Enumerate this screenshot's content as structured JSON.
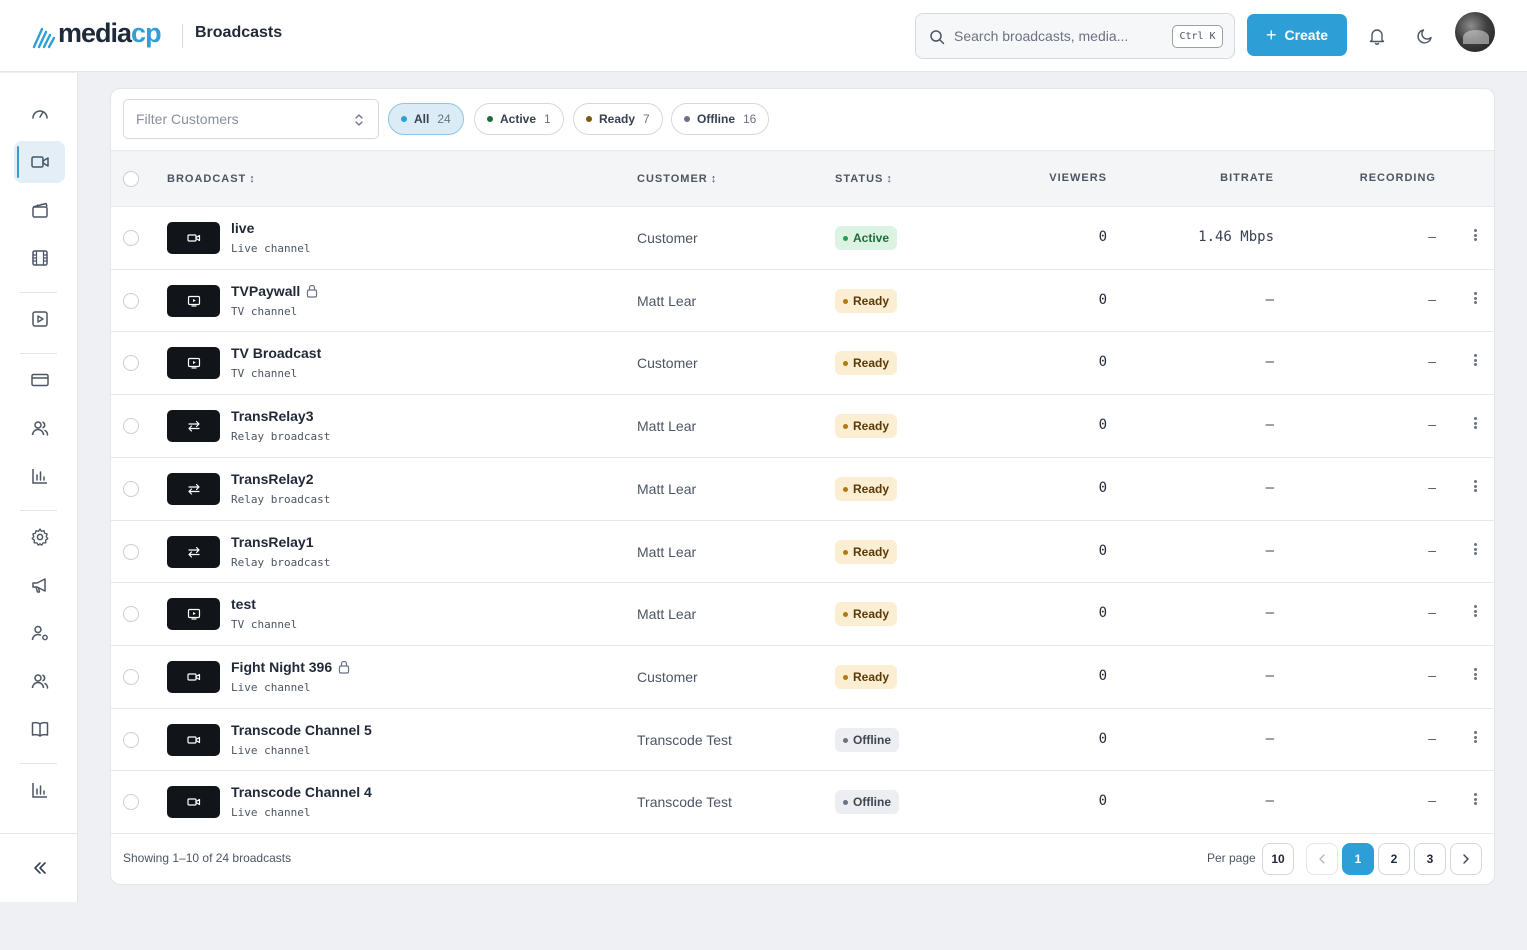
{
  "header": {
    "logo": {
      "main": "media",
      "accent": "cp"
    },
    "page_title": "Broadcasts",
    "search_placeholder": "Search broadcasts, media...",
    "search_shortcut": "Ctrl K",
    "create_label": "Create",
    "icons": [
      "bell-icon",
      "moon-icon",
      "avatar"
    ]
  },
  "sidebar": {
    "items": [
      {
        "name": "dashboard",
        "icon": "gauge-icon",
        "active": false
      },
      {
        "name": "broadcasts",
        "icon": "video-camera-icon",
        "active": true
      },
      {
        "name": "media",
        "icon": "clapperboard-icon",
        "active": false
      },
      {
        "name": "videos",
        "icon": "film-icon",
        "active": false
      },
      {
        "name": "players",
        "icon": "play-square-icon",
        "active": false
      },
      {
        "name": "billing",
        "icon": "credit-card-icon",
        "active": false
      },
      {
        "name": "customers",
        "icon": "users-icon",
        "active": false
      },
      {
        "name": "analytics",
        "icon": "bar-chart-icon",
        "active": false
      },
      {
        "name": "settings",
        "icon": "gear-icon",
        "active": false
      },
      {
        "name": "announcements",
        "icon": "megaphone-icon",
        "active": false
      },
      {
        "name": "user-settings",
        "icon": "user-gear-icon",
        "active": false
      },
      {
        "name": "team",
        "icon": "users-icon",
        "active": false
      },
      {
        "name": "docs",
        "icon": "book-icon",
        "active": false
      },
      {
        "name": "reports",
        "icon": "bar-chart-icon",
        "active": false
      }
    ],
    "collapse_icon": "chevrons-left-icon"
  },
  "filters": {
    "customer_placeholder": "Filter Customers",
    "pills": [
      {
        "label": "All",
        "count": "24",
        "color": "#2d9fd6",
        "selected": true
      },
      {
        "label": "Active",
        "count": "1",
        "color": "#1f6b3a",
        "selected": false
      },
      {
        "label": "Ready",
        "count": "7",
        "color": "#7a5a10",
        "selected": false
      },
      {
        "label": "Offline",
        "count": "16",
        "color": "#6b7280",
        "selected": false
      }
    ]
  },
  "table": {
    "columns": {
      "broadcast": "Broadcast",
      "customer": "Customer",
      "status": "Status",
      "viewers": "Viewers",
      "bitrate": "Bitrate",
      "recording": "Recording"
    },
    "rows": [
      {
        "name": "live",
        "type": "Live channel",
        "icon": "video-camera-icon",
        "locked": false,
        "customer": "Customer",
        "status": "Active",
        "viewers": "0",
        "bitrate": "1.46 Mbps",
        "recording": "–"
      },
      {
        "name": "TVPaywall",
        "type": "TV channel",
        "icon": "tv-icon",
        "locked": true,
        "customer": "Matt Lear",
        "status": "Ready",
        "viewers": "0",
        "bitrate": "–",
        "recording": "–"
      },
      {
        "name": "TV Broadcast",
        "type": "TV channel",
        "icon": "tv-icon",
        "locked": false,
        "customer": "Customer",
        "status": "Ready",
        "viewers": "0",
        "bitrate": "–",
        "recording": "–"
      },
      {
        "name": "TransRelay3",
        "type": "Relay broadcast",
        "icon": "relay-arrows-icon",
        "locked": false,
        "customer": "Matt Lear",
        "status": "Ready",
        "viewers": "0",
        "bitrate": "–",
        "recording": "–"
      },
      {
        "name": "TransRelay2",
        "type": "Relay broadcast",
        "icon": "relay-arrows-icon",
        "locked": false,
        "customer": "Matt Lear",
        "status": "Ready",
        "viewers": "0",
        "bitrate": "–",
        "recording": "–"
      },
      {
        "name": "TransRelay1",
        "type": "Relay broadcast",
        "icon": "relay-arrows-icon",
        "locked": false,
        "customer": "Matt Lear",
        "status": "Ready",
        "viewers": "0",
        "bitrate": "–",
        "recording": "–"
      },
      {
        "name": "test",
        "type": "TV channel",
        "icon": "tv-icon",
        "locked": false,
        "customer": "Matt Lear",
        "status": "Ready",
        "viewers": "0",
        "bitrate": "–",
        "recording": "–"
      },
      {
        "name": "Fight Night 396",
        "type": "Live channel",
        "icon": "video-camera-icon",
        "locked": true,
        "customer": "Customer",
        "status": "Ready",
        "viewers": "0",
        "bitrate": "–",
        "recording": "–"
      },
      {
        "name": "Transcode Channel 5",
        "type": "Live channel",
        "icon": "video-camera-icon",
        "locked": false,
        "customer": "Transcode Test",
        "status": "Offline",
        "viewers": "0",
        "bitrate": "–",
        "recording": "–"
      },
      {
        "name": "Transcode Channel 4",
        "type": "Live channel",
        "icon": "video-camera-icon",
        "locked": false,
        "customer": "Transcode Test",
        "status": "Offline",
        "viewers": "0",
        "bitrate": "–",
        "recording": "–"
      }
    ]
  },
  "footer": {
    "showing": "Showing 1–10 of 24 broadcasts",
    "per_page_label": "Per page",
    "per_page_value": "10",
    "pages": [
      "1",
      "2",
      "3"
    ],
    "current_page": "1"
  }
}
